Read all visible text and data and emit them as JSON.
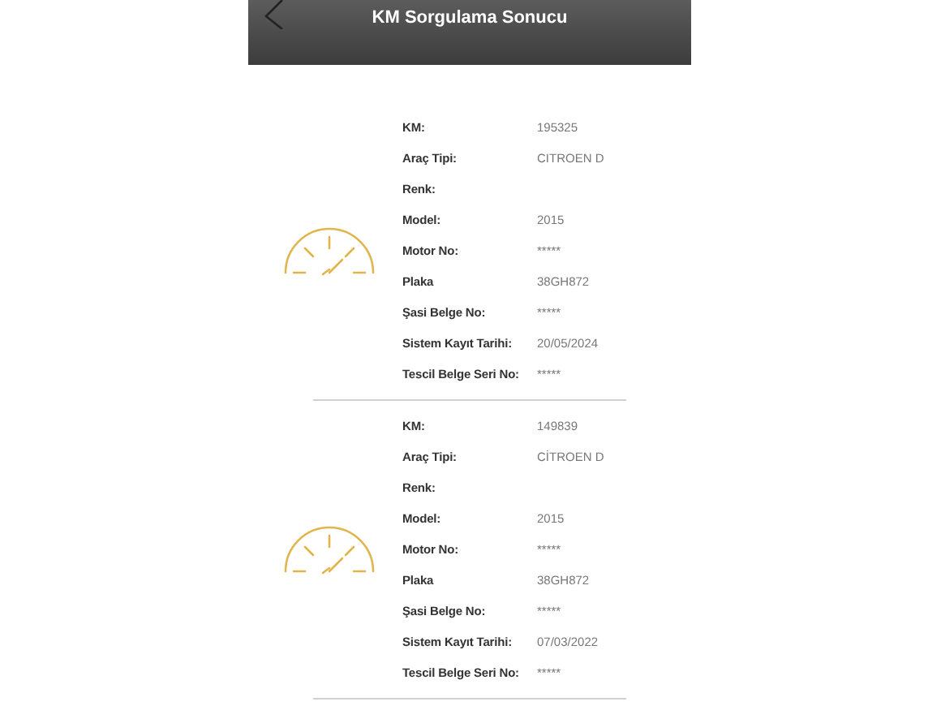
{
  "header": {
    "title": "KM Sorgulama Sonucu"
  },
  "records": [
    {
      "fields": [
        {
          "label": "KM:",
          "value": "195325"
        },
        {
          "label": "Araç Tipi:",
          "value": "CITROEN D"
        },
        {
          "label": "Renk:"
        },
        {
          "label": "Model:",
          "value": "2015"
        },
        {
          "label": "Motor No:",
          "value": "*****"
        },
        {
          "label": "Plaka",
          "value": "38GH872"
        },
        {
          "label": "Şasi Belge No:",
          "value": "*****"
        },
        {
          "label": "Sistem Kayıt Tarihi:",
          "value": "20/05/2024"
        },
        {
          "label": "Tescil Belge Seri No:",
          "value": "*****"
        }
      ]
    },
    {
      "fields": [
        {
          "label": "KM:",
          "value": "149839"
        },
        {
          "label": "Araç Tipi:",
          "value": "CİTROEN D"
        },
        {
          "label": "Renk:"
        },
        {
          "label": "Model:",
          "value": "2015"
        },
        {
          "label": "Motor No:",
          "value": "*****"
        },
        {
          "label": "Plaka",
          "value": "38GH872"
        },
        {
          "label": "Şasi Belge No:",
          "value": "*****"
        },
        {
          "label": "Sistem Kayıt Tarihi:",
          "value": "07/03/2022"
        },
        {
          "label": "Tescil Belge Seri No:",
          "value": "*****"
        }
      ]
    }
  ]
}
